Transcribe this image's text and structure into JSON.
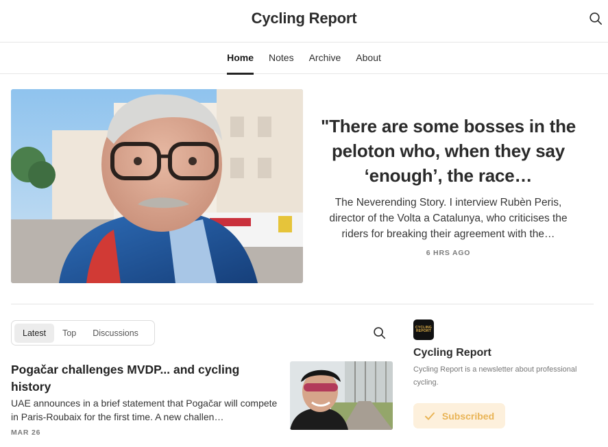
{
  "header": {
    "title": "Cycling Report",
    "search_icon": "search-icon"
  },
  "nav": {
    "items": [
      {
        "label": "Home",
        "active": true
      },
      {
        "label": "Notes",
        "active": false
      },
      {
        "label": "Archive",
        "active": false
      },
      {
        "label": "About",
        "active": false
      }
    ]
  },
  "hero": {
    "title": "\"There are some bosses in the peloton who, when they say ‘enough’, the race…",
    "subtitle": "The Neverending Story. I interview Rubèn Peris, director of the Volta a Catalunya, who criticises the riders for breaking their agreement with the…",
    "date": "6 HRS AGO"
  },
  "tabs": {
    "items": [
      {
        "label": "Latest",
        "active": true
      },
      {
        "label": "Top",
        "active": false
      },
      {
        "label": "Discussions",
        "active": false
      }
    ]
  },
  "post": {
    "title": "Pogačar challenges MVDP... and cycling history",
    "subtitle": "UAE announces in a brief statement that Pogačar will compete in Paris-Roubaix for the first time. A new challen…",
    "date": "MAR 26"
  },
  "sidebar": {
    "logo_line1": "CYCLING",
    "logo_line2": "REPORT",
    "name": "Cycling Report",
    "description": "Cycling Report is a newsletter about professional cycling.",
    "subscribed_label": "Subscribed"
  },
  "colors": {
    "accent": "#e9b456",
    "subscribed_bg": "#fdf0dc",
    "text": "#2a2a2a",
    "muted": "#7a7a7a",
    "divider": "#e3e3e3"
  }
}
